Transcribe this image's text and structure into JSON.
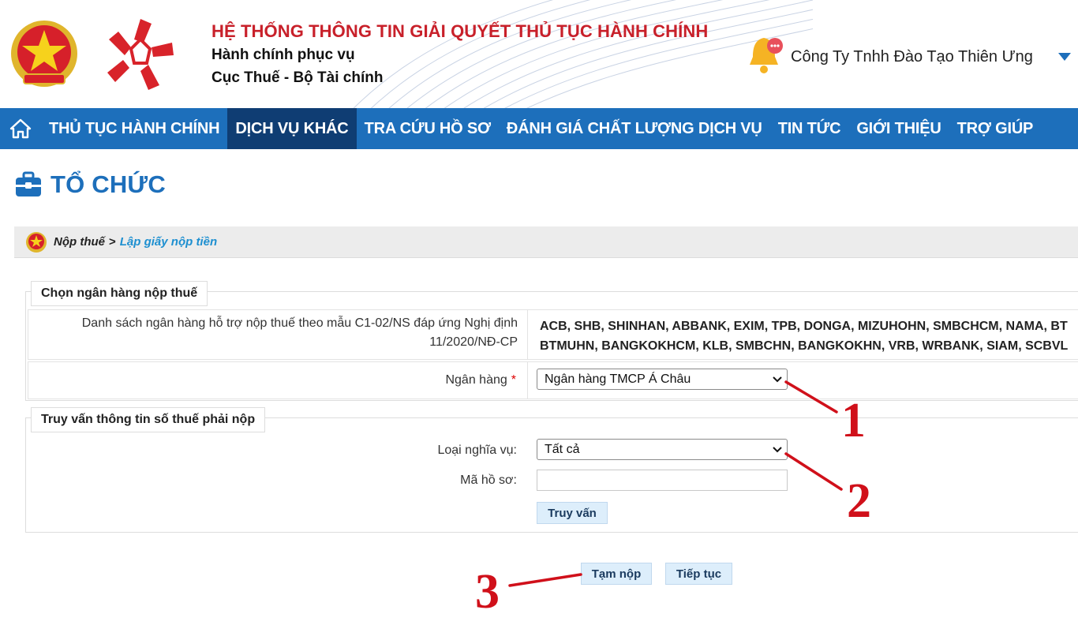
{
  "header": {
    "title": "HỆ THỐNG THÔNG TIN GIẢI QUYẾT THỦ TỤC HÀNH CHÍNH",
    "subtitle1": "Hành chính phục vụ",
    "subtitle2": "Cục Thuế - Bộ Tài chính",
    "user_name": "Công Ty Tnhh Đào Tạo Thiên Ưng"
  },
  "nav": {
    "items": [
      {
        "label": "THỦ TỤC HÀNH CHÍNH"
      },
      {
        "label": "DỊCH VỤ KHÁC"
      },
      {
        "label": "TRA CỨU HỒ SƠ"
      },
      {
        "label": "ĐÁNH GIÁ CHẤT LƯỢNG DỊCH VỤ"
      },
      {
        "label": "TIN TỨC"
      },
      {
        "label": "GIỚI THIỆU"
      },
      {
        "label": "TRỢ GIÚP"
      }
    ],
    "active_index": 1
  },
  "page": {
    "title": "TỔ CHỨC"
  },
  "breadcrumb": {
    "root": "Nộp thuế",
    "separator": ">",
    "current": "Lập giấy nộp tiền"
  },
  "bank_section": {
    "legend": "Chọn ngân hàng nộp thuế",
    "list_label_line1": "Danh sách ngân hàng hỗ trợ nộp thuế theo mẫu C1-02/NS đáp ứng Nghị định",
    "list_label_line2": "11/2020/NĐ-CP",
    "banks_line1": "ACB, SHB, SHINHAN, ABBANK, EXIM, TPB, DONGA, MIZUHOHN, SMBCHCM, NAMA, BT",
    "banks_line2": "BTMUHN, BANGKOKHCM, KLB, SMBCHN, BANGKOKHN, VRB, WRBANK, SIAM, SCBVL",
    "bank_label": "Ngân hàng",
    "required_mark": "*",
    "bank_selected": "Ngân hàng TMCP Á Châu"
  },
  "query_section": {
    "legend": "Truy vấn thông tin số thuế phải nộp",
    "obligation_label": "Loại nghĩa vụ:",
    "obligation_selected": "Tất cả",
    "file_code_label": "Mã hồ sơ:",
    "file_code_value": "",
    "query_button": "Truy vấn"
  },
  "actions": {
    "temp_pay": "Tạm nộp",
    "continue": "Tiếp tục"
  },
  "annotations": {
    "n1": "1",
    "n2": "2",
    "n3": "3"
  },
  "colors": {
    "nav_bg": "#1d6fbb",
    "nav_active": "#0f3d73",
    "title_red": "#c8202a",
    "page_title_blue": "#1d6fbb",
    "annotation_red": "#d0101a"
  }
}
